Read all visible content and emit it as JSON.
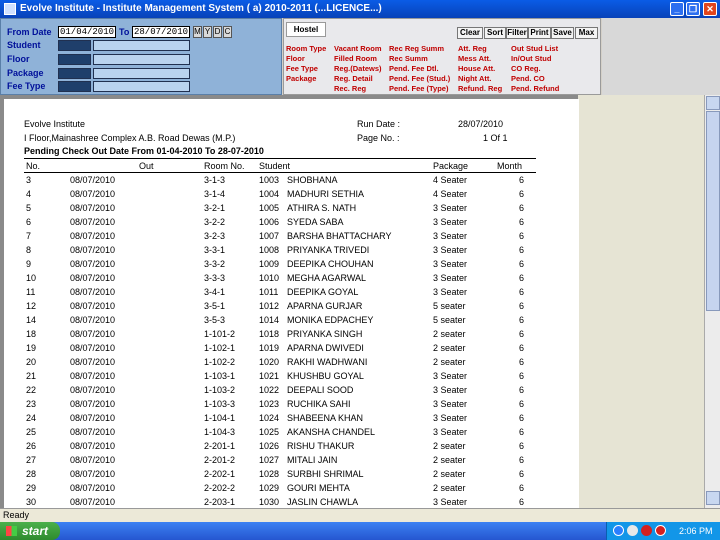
{
  "window": {
    "title": "Evolve Institute - Institute Management System ( a) 2010-2011 (...LICENCE...)"
  },
  "filters": {
    "from_label": "From Date",
    "from_value": "01/04/2010",
    "to_label": "To",
    "to_value": "28/07/2010",
    "range_buttons": [
      "M",
      "Y",
      "D",
      "C"
    ],
    "rows": [
      "Student",
      "Floor",
      "Package",
      "Fee Type"
    ]
  },
  "hostel": {
    "tab_label": "Hostel",
    "toolbar": [
      "Clear",
      "Sort",
      "Filter",
      "Print",
      "Save",
      "Max"
    ],
    "links": [
      [
        "Room Type",
        "Vacant Room",
        "Rec Reg Summ",
        "Att. Reg",
        "Out Stud List"
      ],
      [
        "Floor",
        "Filled Room",
        "Rec Summ",
        "Mess Att.",
        "In/Out Stud"
      ],
      [
        "Fee Type",
        "Reg.(Datews)",
        "Pend. Fee Dtl.",
        "House Att.",
        "CO Reg."
      ],
      [
        "Package",
        "Reg. Detail",
        "Pend. Fee (Stud.)",
        "Night Att.",
        "Pend. CO"
      ],
      [
        "",
        "Rec. Reg",
        "Pend. Fee (Type)",
        "Refund. Reg",
        "Pend. Refund"
      ]
    ]
  },
  "report": {
    "institute": "Evolve Institute",
    "address": "I Floor,Mainashree Complex A.B. Road Dewas (M.P.)",
    "title": "Pending Check Out Date From 01-04-2010 To 28-07-2010",
    "run_date_label": "Run Date :",
    "run_date": "28/07/2010",
    "page_label": "Page No. :",
    "page_value": "1 Of 1",
    "columns": [
      "No.",
      "Out",
      "Room No.",
      "Student",
      "Package",
      "Month"
    ],
    "rows": [
      [
        "3",
        "08/07/2010",
        "3-1-3",
        "1003",
        "SHOBHANA",
        "4 Seater",
        "6"
      ],
      [
        "4",
        "08/07/2010",
        "3-1-4",
        "1004",
        "MADHURI  SETHIA",
        "4 Seater",
        "6"
      ],
      [
        "5",
        "08/07/2010",
        "3-2-1",
        "1005",
        "ATHIRA  S. NATH",
        "3 Seater",
        "6"
      ],
      [
        "6",
        "08/07/2010",
        "3-2-2",
        "1006",
        "SYEDA  SABA",
        "3 Seater",
        "6"
      ],
      [
        "7",
        "08/07/2010",
        "3-2-3",
        "1007",
        "BARSHA  BHATTACHARY",
        "3 Seater",
        "6"
      ],
      [
        "8",
        "08/07/2010",
        "3-3-1",
        "1008",
        "PRIYANKA  TRIVEDI",
        "3 Seater",
        "6"
      ],
      [
        "9",
        "08/07/2010",
        "3-3-2",
        "1009",
        "DEEPIKA  CHOUHAN",
        "3 Seater",
        "6"
      ],
      [
        "10",
        "08/07/2010",
        "3-3-3",
        "1010",
        "MEGHA  AGARWAL",
        "3 Seater",
        "6"
      ],
      [
        "11",
        "08/07/2010",
        "3-4-1",
        "1011",
        "DEEPIKA  GOYAL",
        "3 Seater",
        "6"
      ],
      [
        "12",
        "08/07/2010",
        "3-5-1",
        "1012",
        "APARNA  GURJAR",
        "5 seater",
        "6"
      ],
      [
        "14",
        "08/07/2010",
        "3-5-3",
        "1014",
        "MONIKA  EDPACHEY",
        "5 seater",
        "6"
      ],
      [
        "18",
        "08/07/2010",
        "1-101-2",
        "1018",
        "PRIYANKA SINGH",
        "2 seater",
        "6"
      ],
      [
        "19",
        "08/07/2010",
        "1-102-1",
        "1019",
        "APARNA  DWIVEDI",
        "2 seater",
        "6"
      ],
      [
        "20",
        "08/07/2010",
        "1-102-2",
        "1020",
        "RAKHI WADHWANI",
        "2 seater",
        "6"
      ],
      [
        "21",
        "08/07/2010",
        "1-103-1",
        "1021",
        "KHUSHBU  GOYAL",
        "3 Seater",
        "6"
      ],
      [
        "22",
        "08/07/2010",
        "1-103-2",
        "1022",
        "DEEPALI  SOOD",
        "3 Seater",
        "6"
      ],
      [
        "23",
        "08/07/2010",
        "1-103-3",
        "1023",
        "RUCHIKA  SAHI",
        "3 Seater",
        "6"
      ],
      [
        "24",
        "08/07/2010",
        "1-104-1",
        "1024",
        "SHABEENA KHAN",
        "3 Seater",
        "6"
      ],
      [
        "25",
        "08/07/2010",
        "1-104-3",
        "1025",
        "AKANSHA CHANDEL",
        "3 Seater",
        "6"
      ],
      [
        "26",
        "08/07/2010",
        "2-201-1",
        "1026",
        "RISHU  THAKUR",
        "2 seater",
        "6"
      ],
      [
        "27",
        "08/07/2010",
        "2-201-2",
        "1027",
        "MITALI  JAIN",
        "2 seater",
        "6"
      ],
      [
        "28",
        "08/07/2010",
        "2-202-1",
        "1028",
        "SURBHI  SHRIMAL",
        "2 seater",
        "6"
      ],
      [
        "29",
        "08/07/2010",
        "2-202-2",
        "1029",
        "GOURI  MEHTA",
        "2 seater",
        "6"
      ],
      [
        "30",
        "08/07/2010",
        "2-203-1",
        "1030",
        "JASLIN  CHAWLA",
        "3 Seater",
        "6"
      ]
    ]
  },
  "status": {
    "text": "Ready"
  },
  "taskbar": {
    "start_label": "start",
    "clock": "2:06 PM"
  }
}
